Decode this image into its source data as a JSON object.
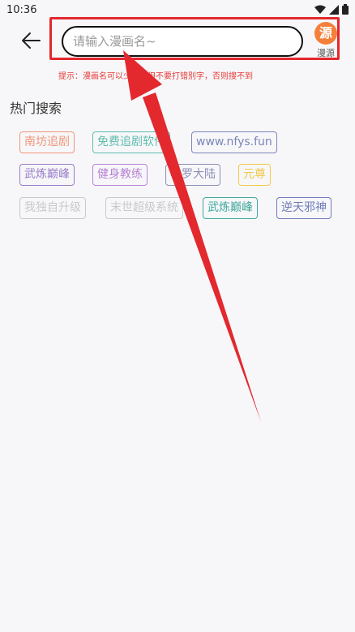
{
  "status_bar": {
    "time": "10:36"
  },
  "search": {
    "placeholder": "请输入漫画名~",
    "source_icon_text": "源",
    "source_label": "漫源"
  },
  "tip": "提示：漫画名可以少打，但不要打错别字，否则搜不到",
  "hot": {
    "title": "热门搜索",
    "tags": [
      {
        "label": "南坊追剧",
        "color": "#f0967a"
      },
      {
        "label": "免费追剧软件",
        "color": "#5fbcae"
      },
      {
        "label": "www.nfys.fun",
        "color": "#7b86b8"
      },
      {
        "label": "武炼巅峰",
        "color": "#9a7cc9"
      },
      {
        "label": "健身教练",
        "color": "#b683d3"
      },
      {
        "label": "斗罗大陆",
        "color": "#8c8fb8"
      },
      {
        "label": "元尊",
        "color": "#f2c94c"
      },
      {
        "label": "我独自升级",
        "color": "#c9c9c9"
      },
      {
        "label": "末世超级系统",
        "color": "#c9c9c9"
      },
      {
        "label": "武炼巅峰",
        "color": "#3fa89c"
      },
      {
        "label": "逆天邪神",
        "color": "#6f7bb8"
      }
    ]
  },
  "colors": {
    "highlight": "#e3282e",
    "source_accent": "#f47f3a",
    "tip_text": "#e53935"
  }
}
